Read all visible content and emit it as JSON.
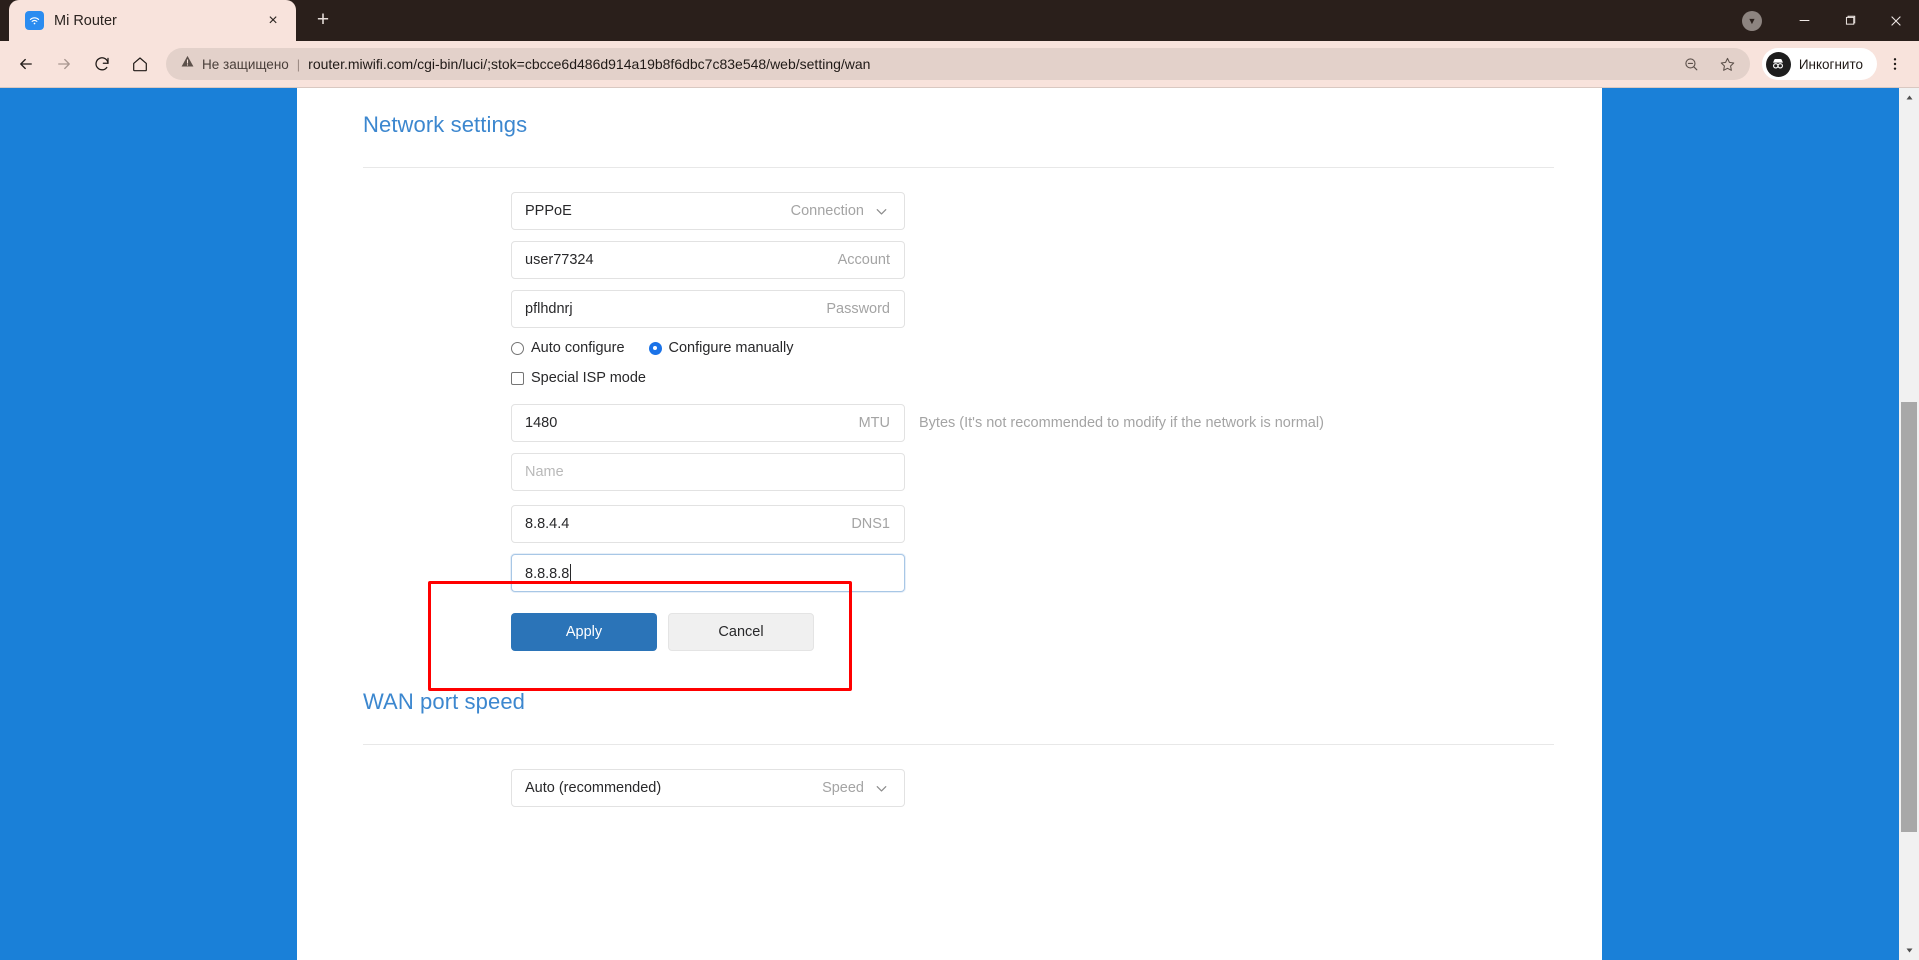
{
  "browser": {
    "tab": {
      "title": "Mi Router",
      "favicon": "wifi-icon",
      "close": "×"
    },
    "new_tab_label": "+",
    "window_controls": {
      "extra": "▼",
      "minimize": "—",
      "maximize": "❐",
      "close": "✕"
    },
    "toolbar": {
      "back": "←",
      "forward": "→",
      "reload": "⟳",
      "home": "⌂",
      "security_label": "Не защищено",
      "separator": "|",
      "url": "router.miwifi.com/cgi-bin/luci/;stok=cbcce6d486d914a19b8f6dbc7c83e548/web/setting/wan",
      "zoom_out_icon": "zoom-out-icon",
      "bookmark_icon": "star-icon",
      "profile_label": "Инкогнито",
      "menu_icon": "kebab-menu-icon"
    }
  },
  "page": {
    "network_settings": {
      "title": "Network settings",
      "connection": {
        "value": "PPPoE",
        "label": "Connection"
      },
      "account": {
        "value": "user77324",
        "label": "Account"
      },
      "password": {
        "value": "pflhdnrj",
        "label": "Password"
      },
      "config_mode": {
        "auto": {
          "label": "Auto configure",
          "selected": false
        },
        "manual": {
          "label": "Configure manually",
          "selected": true
        }
      },
      "special_isp": {
        "label": "Special ISP mode",
        "checked": false
      },
      "mtu": {
        "value": "1480",
        "label": "MTU",
        "hint": "Bytes (It's not recommended to modify if the network is normal)"
      },
      "name": {
        "value": "",
        "placeholder": "Name",
        "label": ""
      },
      "dns1": {
        "value": "8.8.4.4",
        "label": "DNS1"
      },
      "dns2": {
        "value": "8.8.8.8",
        "label": "",
        "focused": true
      },
      "apply_button": "Apply",
      "cancel_button": "Cancel"
    },
    "wan_port_speed": {
      "title": "WAN port speed",
      "speed": {
        "value": "Auto (recommended)",
        "label": "Speed"
      }
    }
  },
  "colors": {
    "page_background": "#1a80d8",
    "card_background": "#ffffff",
    "section_title": "#3c87cf",
    "primary_button": "#2b74b8",
    "highlight_border": "#ff0000",
    "radio_selected": "#1b73e8",
    "chrome_titlebar": "#2a1f1b",
    "chrome_toolbar": "#f8e3dc"
  },
  "scrollbar": {
    "up_arrow": "▲",
    "down_arrow": "▼"
  }
}
